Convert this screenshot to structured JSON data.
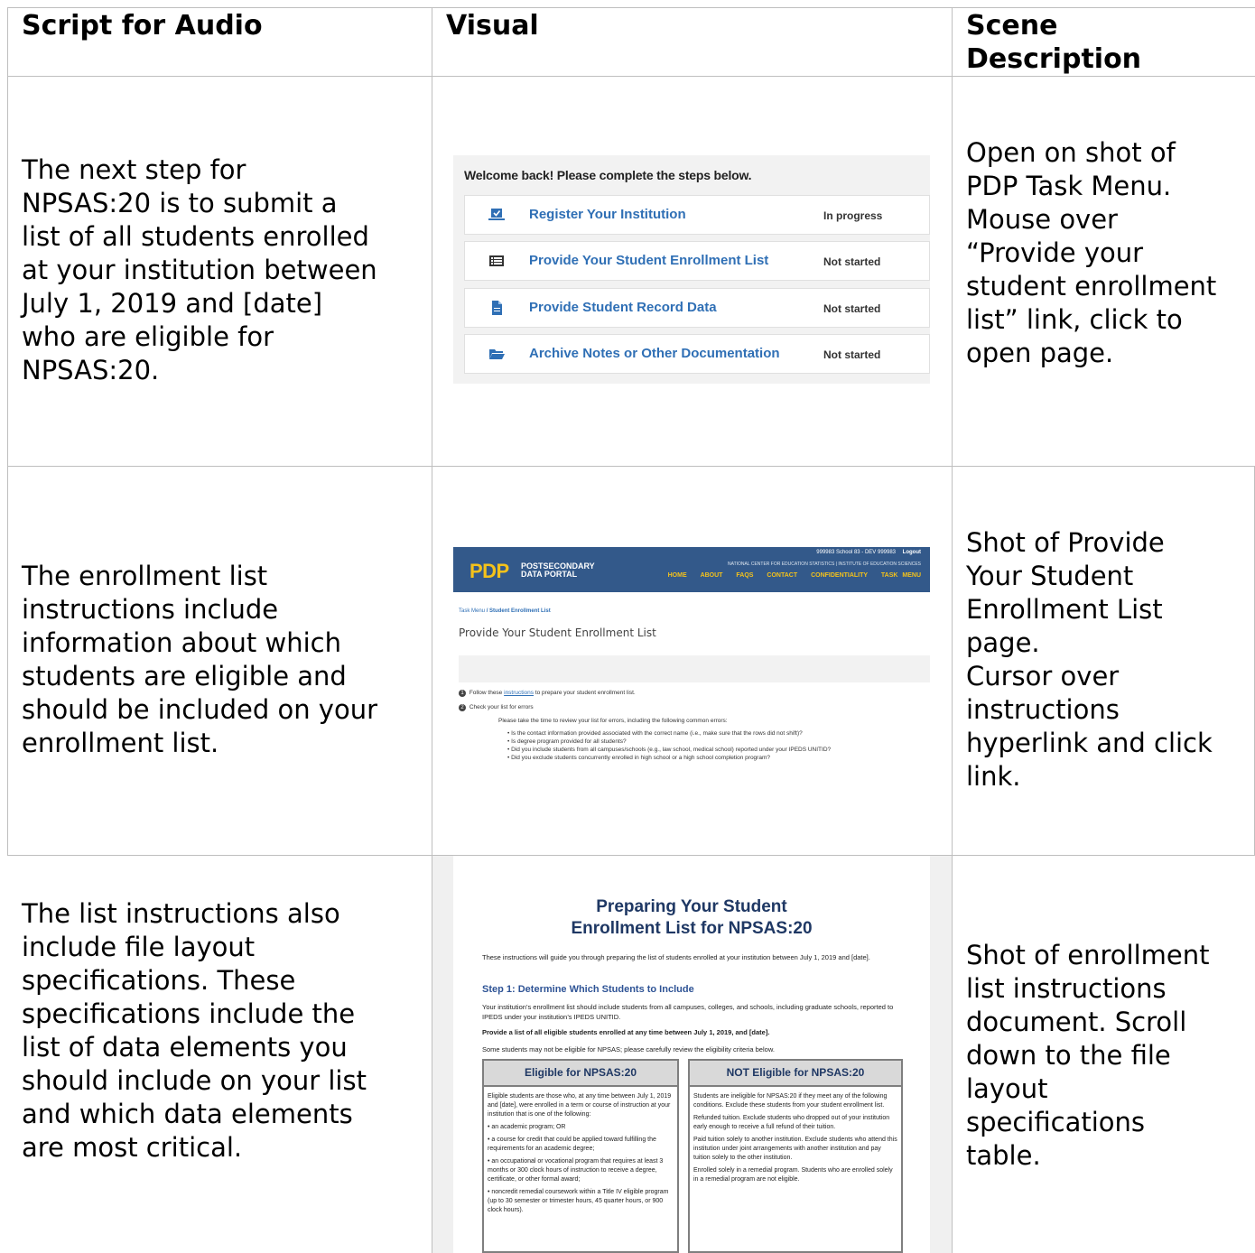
{
  "headers": {
    "col1": "Script for Audio",
    "col2": "Visual",
    "col3a": "Scene",
    "col3b": "Description"
  },
  "rows": [
    {
      "script": [
        "The next step for",
        "NPSAS:20 is to submit a",
        "list of all students enrolled",
        "at your institution between",
        "July 1, 2019 and [date]",
        "who are eligible for",
        "NPSAS:20."
      ],
      "scene": [
        "Open on shot of",
        "PDP Task Menu.",
        "Mouse over",
        "“Provide your",
        "student enrollment",
        "list” link, click to",
        "open page."
      ]
    },
    {
      "script": [
        "The enrollment list",
        "instructions include",
        "information about which",
        "students are eligible and",
        "should be included on your",
        "enrollment list."
      ],
      "scene": [
        "Shot of Provide",
        "Your Student",
        "Enrollment List",
        "page.",
        "Cursor over",
        "instructions",
        "hyperlink and click",
        "link."
      ]
    },
    {
      "script": [
        "The list instructions also",
        "include file layout",
        "specifications. These",
        "specifications include the",
        "list of data elements you",
        "should include on your list",
        "and which data elements",
        "are most critical."
      ],
      "scene": [
        "Shot of enrollment",
        "list instructions",
        "document. Scroll",
        "down to the file",
        "layout",
        "specifications",
        "table."
      ]
    }
  ],
  "task_menu": {
    "welcome": "Welcome back! Please complete the steps below.",
    "tasks": [
      {
        "label": "Register Your Institution",
        "status": "In progress",
        "icon": "laptop-check-icon"
      },
      {
        "label": "Provide Your Student Enrollment List",
        "status": "Not started",
        "icon": "list-icon"
      },
      {
        "label": "Provide Student Record Data",
        "status": "Not started",
        "icon": "document-icon"
      },
      {
        "label": "Archive Notes or Other Documentation",
        "status": "Not started",
        "icon": "folder-icon"
      }
    ]
  },
  "pdp_page": {
    "logo": "PDP",
    "logo_line1": "POSTSECONDARY",
    "logo_line2": "DATA PORTAL",
    "topline": "999983 School 83 - DEV  999983",
    "logout": "Logout",
    "org": "NATIONAL CENTER FOR EDUCATION STATISTICS  |  INSTITUTE OF EDUCATION SCIENCES",
    "nav": [
      "HOME",
      "ABOUT",
      "FAQS",
      "CONTACT",
      "CONFIDENTIALITY",
      "TASK MENU"
    ],
    "breadcrumb_link": "Task Menu",
    "breadcrumb_current": "/ Student Enrollment List",
    "title": "Provide Your Student Enrollment List",
    "step1_pre": "Follow these",
    "step1_link": "instructions",
    "step1_post": "to prepare your student enrollment list.",
    "step2": "Check your list for errors",
    "step2_intro": "Please take the time to review your list for errors, including the following common errors:",
    "bullets": [
      "Is the contact information provided associated with the correct name (i.e., make sure that the rows did not shift)?",
      "Is degree program provided for all students?",
      "Did you include students from all campuses/schools (e.g., law school, medical school) reported under your IPEDS UNITID?",
      "Did you exclude students concurrently enrolled in high school or a high school completion program?"
    ]
  },
  "instructions_doc": {
    "title1": "Preparing Your Student",
    "title2": "Enrollment List for NPSAS:20",
    "intro": "These instructions will guide you through preparing the list of students enrolled at your institution between July 1, 2019 and [date].",
    "step1": "Step 1: Determine Which Students to Include",
    "p1": "Your institution’s enrollment list should include students from all campuses, colleges, and schools, including graduate schools, reported to IPEDS under your institution’s IPEDS UNITID.",
    "p2": "Provide a list of all eligible students enrolled at any time between July 1, 2019, and [date].",
    "p3": "Some students may not be eligible for NPSAS; please carefully review the eligibility criteria below.",
    "eligible_title": "Eligible for NPSAS:20",
    "eligible_intro": "Eligible students are those who, at any time between July 1, 2019 and [date], were enrolled in a term or course of instruction at your institution that is one of the following:",
    "eligible_items": [
      "• an academic program; OR",
      "• a course for credit that could be applied toward fulfilling the requirements for an academic degree;",
      "• an occupational or vocational program that requires at least 3 months or 300 clock hours of instruction to receive a degree, certificate, or other formal award;",
      "• noncredit remedial coursework within a Title IV eligible program (up to 30 semester or trimester hours, 45 quarter hours, or 900 clock hours)."
    ],
    "not_eligible_title": "NOT Eligible for NPSAS:20",
    "not_eligible_intro": "Students are ineligible for NPSAS:20 if they meet any of the following conditions. Exclude these students from your student enrollment list.",
    "not_eligible_items": [
      "Refunded tuition. Exclude students who dropped out of your institution early enough to receive a full refund of their tuition.",
      "Paid tuition solely to another institution. Exclude students who attend this institution under joint arrangements with another institution and pay tuition solely to the other institution.",
      "Enrolled solely in a remedial program. Students who are enrolled solely in a remedial program are not eligible."
    ]
  }
}
